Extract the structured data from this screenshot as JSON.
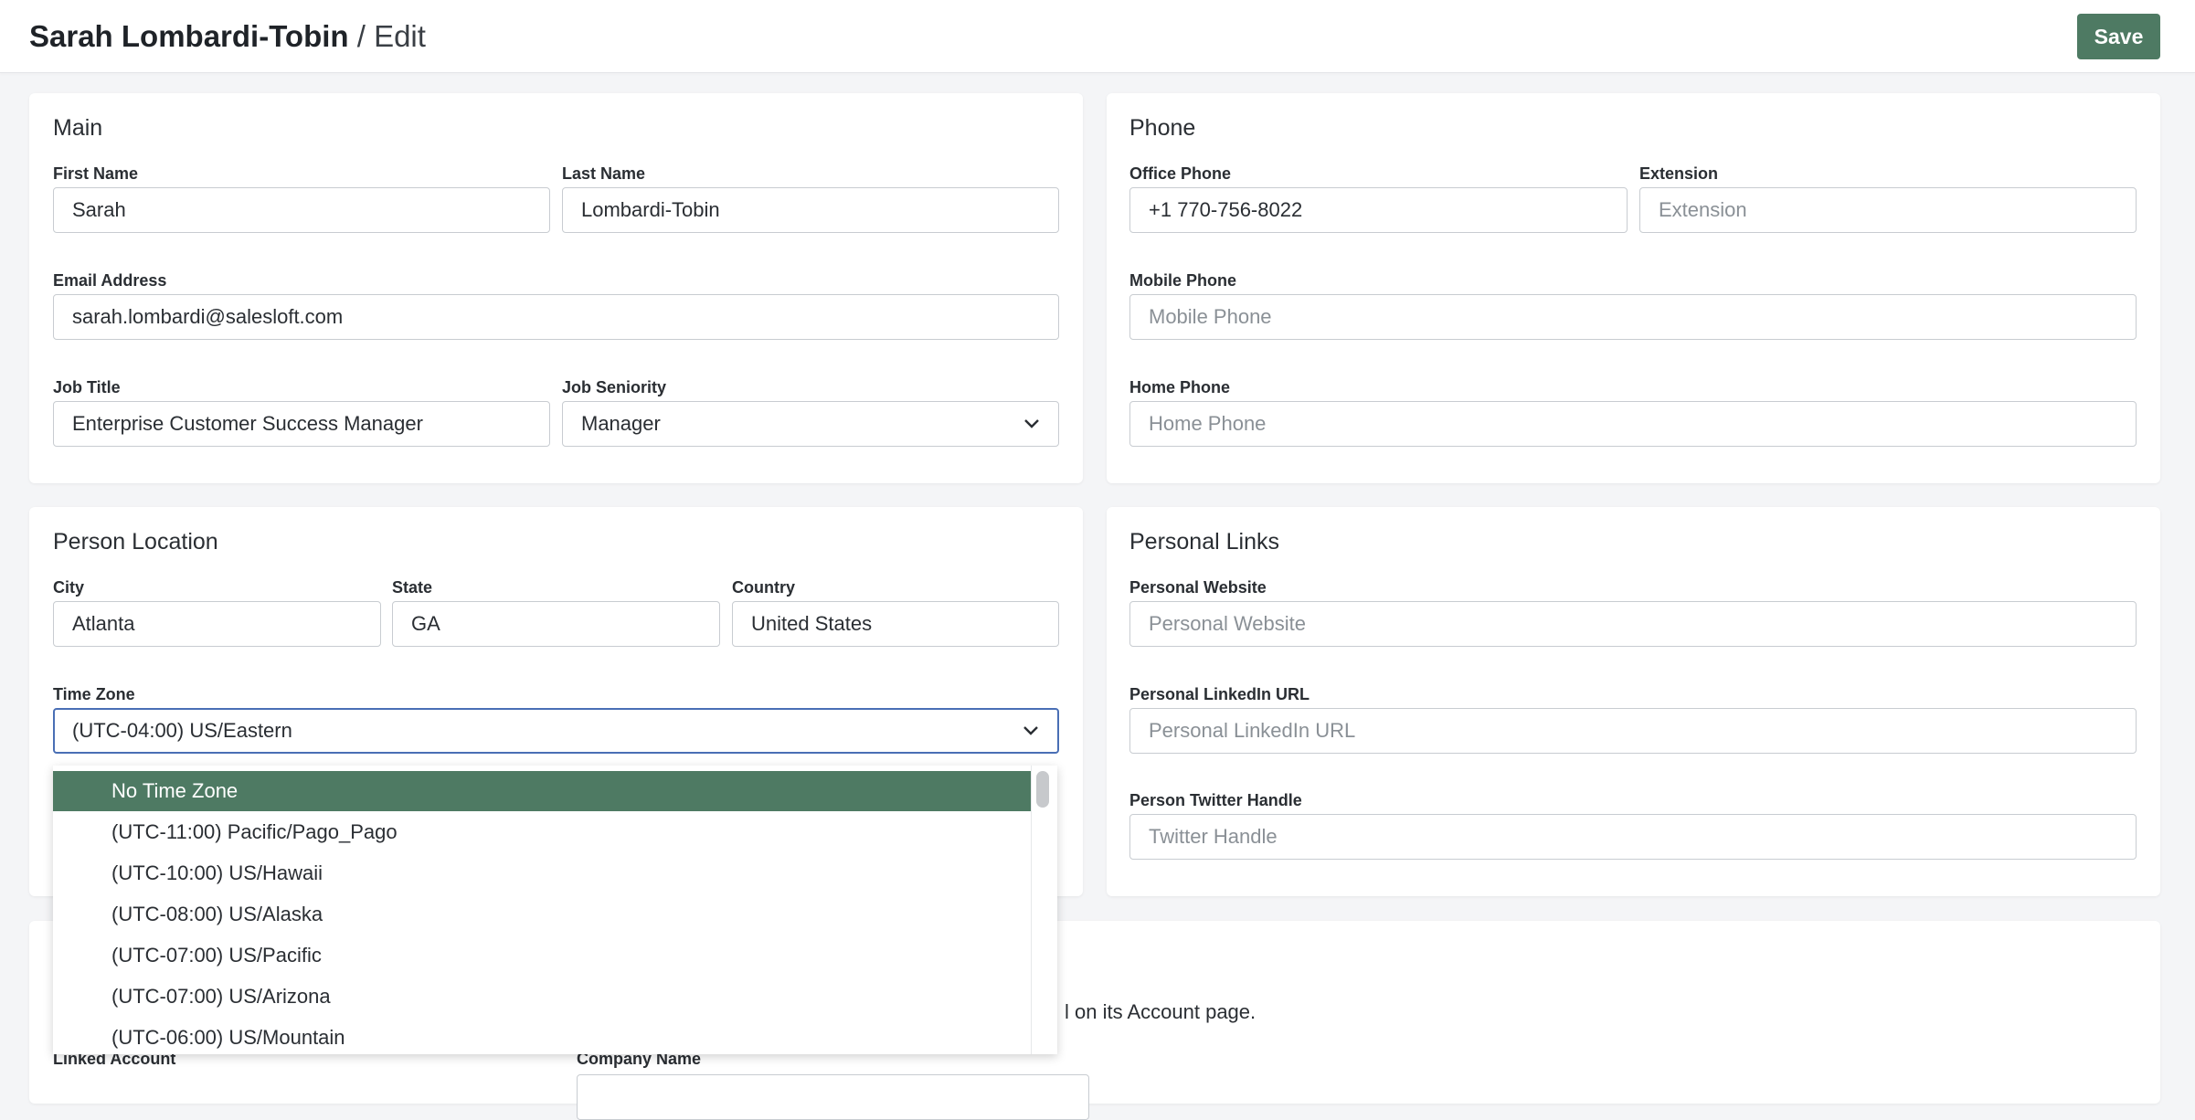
{
  "header": {
    "person_name": "Sarah Lombardi-Tobin",
    "separator_edit": " / Edit",
    "save_label": "Save"
  },
  "colors": {
    "accent": "#4e7a63",
    "focus_border": "#4a6fb5",
    "background": "#f4f5f7"
  },
  "main": {
    "title": "Main",
    "first_name": {
      "label": "First Name",
      "value": "Sarah"
    },
    "last_name": {
      "label": "Last Name",
      "value": "Lombardi-Tobin"
    },
    "email": {
      "label": "Email Address",
      "value": "sarah.lombardi@salesloft.com"
    },
    "job_title": {
      "label": "Job Title",
      "value": "Enterprise Customer Success Manager"
    },
    "job_seniority": {
      "label": "Job Seniority",
      "value": "Manager"
    }
  },
  "phone": {
    "title": "Phone",
    "office": {
      "label": "Office Phone",
      "value": "+1 770-756-8022"
    },
    "extension": {
      "label": "Extension",
      "placeholder": "Extension"
    },
    "mobile": {
      "label": "Mobile Phone",
      "placeholder": "Mobile Phone"
    },
    "home": {
      "label": "Home Phone",
      "placeholder": "Home Phone"
    }
  },
  "location": {
    "title": "Person Location",
    "city": {
      "label": "City",
      "value": "Atlanta"
    },
    "state": {
      "label": "State",
      "value": "GA"
    },
    "country": {
      "label": "Country",
      "value": "United States"
    },
    "time_zone": {
      "label": "Time Zone",
      "value": "(UTC-04:00) US/Eastern",
      "options": [
        "No Time Zone",
        "(UTC-11:00) Pacific/Pago_Pago",
        "(UTC-10:00) US/Hawaii",
        "(UTC-08:00) US/Alaska",
        "(UTC-07:00) US/Pacific",
        "(UTC-07:00) US/Arizona",
        "(UTC-06:00) US/Mountain"
      ],
      "highlighted_option": "No Time Zone"
    }
  },
  "links": {
    "title": "Personal Links",
    "website": {
      "label": "Personal Website",
      "placeholder": "Personal Website"
    },
    "linkedin": {
      "label": "Personal LinkedIn URL",
      "placeholder": "Personal LinkedIn URL"
    },
    "twitter": {
      "label": "Person Twitter Handle",
      "placeholder": "Twitter Handle"
    }
  },
  "account": {
    "partial_text": "l on its Account page.",
    "linked_account_label": "Linked Account",
    "company_name_label": "Company Name"
  },
  "icons": {
    "select_chevron": "chevron-down-icon"
  }
}
